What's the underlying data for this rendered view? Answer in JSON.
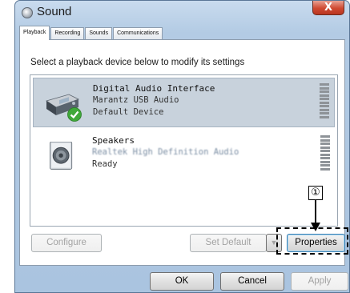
{
  "window": {
    "title": "Sound",
    "close_label": "X"
  },
  "tabs": [
    {
      "label": "Playback",
      "active": true
    },
    {
      "label": "Recording",
      "active": false
    },
    {
      "label": "Sounds",
      "active": false
    },
    {
      "label": "Communications",
      "active": false
    }
  ],
  "instruction": "Select a playback device below to modify its settings",
  "devices": [
    {
      "name": "Digital Audio Interface",
      "driver": "Marantz USB Audio",
      "status": "Default Device",
      "icon": "usb-dac-icon",
      "default_badge": "check-icon"
    },
    {
      "name": "Speakers",
      "driver": "Realtek High Definition Audio",
      "status": "Ready",
      "icon": "speaker-icon"
    }
  ],
  "buttons": {
    "configure": "Configure",
    "set_default": "Set Default",
    "properties": "Properties",
    "ok": "OK",
    "cancel": "Cancel",
    "apply": "Apply"
  },
  "callout": {
    "number": "①"
  }
}
